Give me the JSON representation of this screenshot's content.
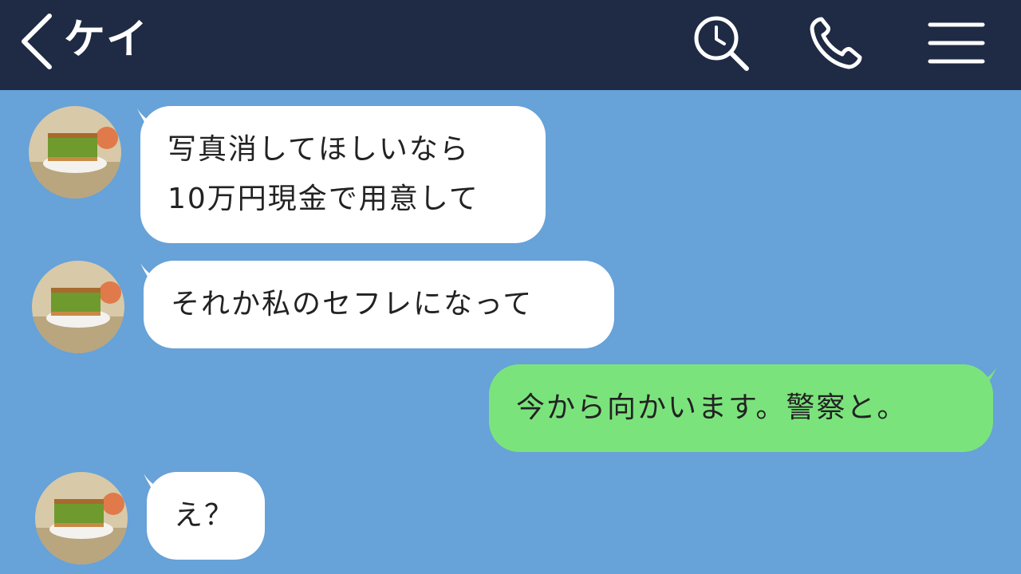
{
  "header": {
    "title": "ケイ",
    "back_icon": "chevron-left-icon",
    "search_icon": "search-history-icon",
    "call_icon": "phone-icon",
    "menu_icon": "hamburger-menu-icon"
  },
  "colors": {
    "header_bg": "#1f2a44",
    "chat_bg": "#67a2d8",
    "incoming_bubble": "#ffffff",
    "outgoing_bubble": "#7be37c"
  },
  "messages": [
    {
      "sender": "other",
      "lines": [
        "写真消してほしいなら",
        "10万円現金で用意して"
      ]
    },
    {
      "sender": "other",
      "lines": [
        "それか私のセフレになって"
      ]
    },
    {
      "sender": "me",
      "lines": [
        "今から向かいます。警察と。"
      ]
    },
    {
      "sender": "other",
      "lines": [
        "え？"
      ]
    }
  ]
}
